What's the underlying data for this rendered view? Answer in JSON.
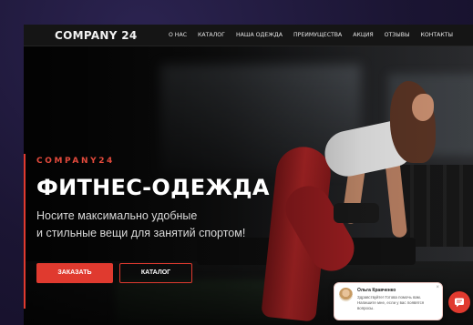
{
  "header": {
    "logo": "COMPANY 24",
    "nav": [
      "О НАС",
      "КАТАЛОГ",
      "НАША ОДЕЖДА",
      "ПРЕИМУЩЕСТВА",
      "АКЦИЯ",
      "ОТЗЫВЫ",
      "КОНТАКТЫ"
    ]
  },
  "hero": {
    "kicker": "COMPANY24",
    "title": "ФИТНЕС-ОДЕЖДА",
    "subtitle_line1": "Носите максимально удобные",
    "subtitle_line2": "и стильные вещи для занятий спортом!",
    "order_button": "ЗАКАЗАТЬ",
    "catalog_button": "КАТАЛОГ"
  },
  "chat": {
    "name": "Ольга Кравченко",
    "message": "Здравствуйте! Готова помочь вам. Напишите мне, если у вас появятся вопросы.",
    "close_icon": "×"
  },
  "colors": {
    "accent": "#e03a2f",
    "background": "#0d0d0d",
    "frame": "#1b1533"
  },
  "icons": {
    "chat_button": "chat-bubble-icon",
    "close": "close-icon"
  }
}
